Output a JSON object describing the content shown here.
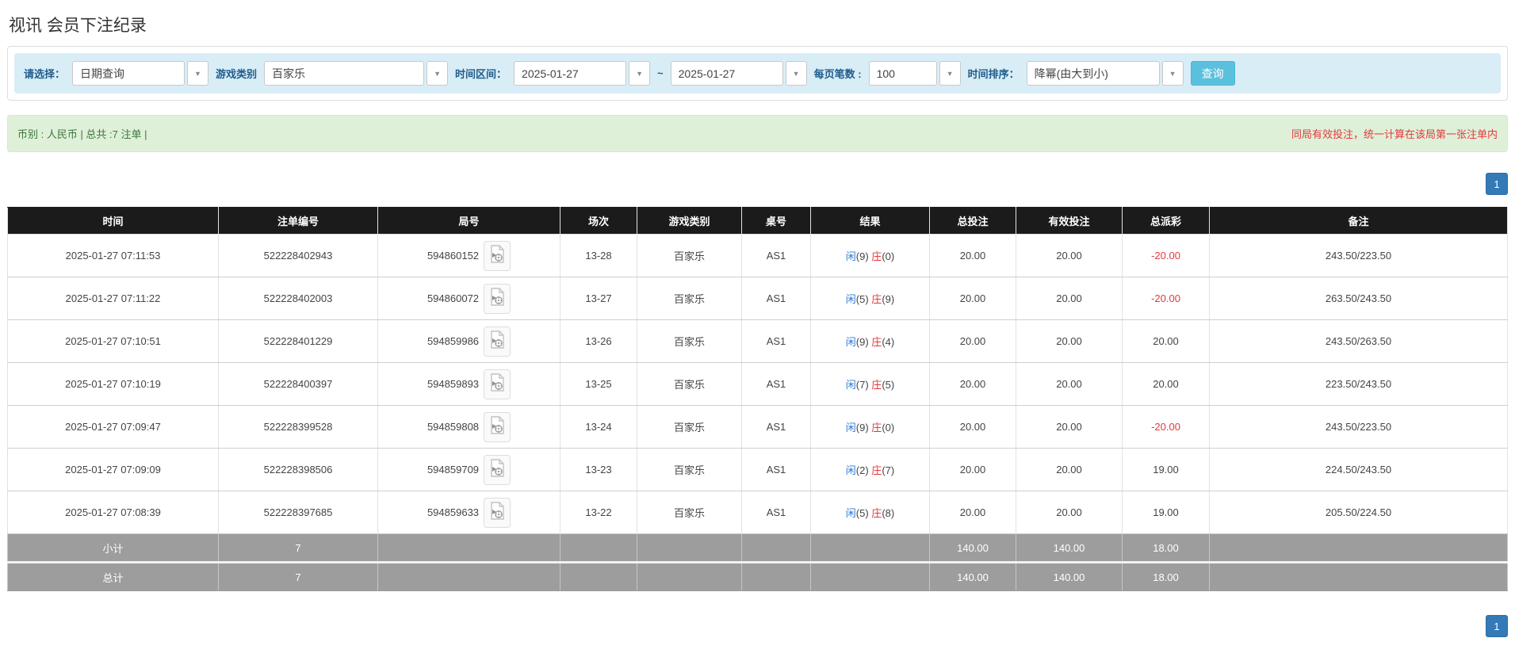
{
  "page_title": "视讯 会员下注纪录",
  "filters": {
    "select_label": "请选择：",
    "query_type": "日期查询",
    "game_category_label": "游戏类别",
    "game_category": "百家乐",
    "date_range_label": "时间区间：",
    "date_from": "2025-01-27",
    "date_tilde": "~",
    "date_to": "2025-01-27",
    "page_size_label": "每页笔数 :",
    "page_size": "100",
    "sort_label": "时间排序：",
    "sort_order": "降幂(由大到小)",
    "search_button": "查询",
    "dropdown_arrow": "▼"
  },
  "summary_bar": {
    "left_text": "币别 : 人民币 | 总共 :7 注单 |",
    "right_notice": "同局有效投注，统一计算在该局第一张注单内"
  },
  "pagination": {
    "page": "1"
  },
  "table": {
    "columns": [
      "时间",
      "注单编号",
      "局号",
      "场次",
      "游戏类别",
      "桌号",
      "结果",
      "总投注",
      "有效投注",
      "总派彩",
      "备注"
    ],
    "rows": [
      {
        "time": "2025-01-27 07:11:53",
        "bet_id": "522228402943",
        "round_id": "594860152",
        "session": "13-28",
        "game": "百家乐",
        "table_no": "AS1",
        "result_player": "闲",
        "result_player_pts": "(9)",
        "result_banker": "庄",
        "result_banker_pts": "(0)",
        "total_bet": "20.00",
        "valid_bet": "20.00",
        "payout": "-20.00",
        "remark": "243.50/223.50"
      },
      {
        "time": "2025-01-27 07:11:22",
        "bet_id": "522228402003",
        "round_id": "594860072",
        "session": "13-27",
        "game": "百家乐",
        "table_no": "AS1",
        "result_player": "闲",
        "result_player_pts": "(5)",
        "result_banker": "庄",
        "result_banker_pts": "(9)",
        "total_bet": "20.00",
        "valid_bet": "20.00",
        "payout": "-20.00",
        "remark": "263.50/243.50"
      },
      {
        "time": "2025-01-27 07:10:51",
        "bet_id": "522228401229",
        "round_id": "594859986",
        "session": "13-26",
        "game": "百家乐",
        "table_no": "AS1",
        "result_player": "闲",
        "result_player_pts": "(9)",
        "result_banker": "庄",
        "result_banker_pts": "(4)",
        "total_bet": "20.00",
        "valid_bet": "20.00",
        "payout": "20.00",
        "remark": "243.50/263.50"
      },
      {
        "time": "2025-01-27 07:10:19",
        "bet_id": "522228400397",
        "round_id": "594859893",
        "session": "13-25",
        "game": "百家乐",
        "table_no": "AS1",
        "result_player": "闲",
        "result_player_pts": "(7)",
        "result_banker": "庄",
        "result_banker_pts": "(5)",
        "total_bet": "20.00",
        "valid_bet": "20.00",
        "payout": "20.00",
        "remark": "223.50/243.50"
      },
      {
        "time": "2025-01-27 07:09:47",
        "bet_id": "522228399528",
        "round_id": "594859808",
        "session": "13-24",
        "game": "百家乐",
        "table_no": "AS1",
        "result_player": "闲",
        "result_player_pts": "(9)",
        "result_banker": "庄",
        "result_banker_pts": "(0)",
        "total_bet": "20.00",
        "valid_bet": "20.00",
        "payout": "-20.00",
        "remark": "243.50/223.50"
      },
      {
        "time": "2025-01-27 07:09:09",
        "bet_id": "522228398506",
        "round_id": "594859709",
        "session": "13-23",
        "game": "百家乐",
        "table_no": "AS1",
        "result_player": "闲",
        "result_player_pts": "(2)",
        "result_banker": "庄",
        "result_banker_pts": "(7)",
        "total_bet": "20.00",
        "valid_bet": "20.00",
        "payout": "19.00",
        "remark": "224.50/243.50"
      },
      {
        "time": "2025-01-27 07:08:39",
        "bet_id": "522228397685",
        "round_id": "594859633",
        "session": "13-22",
        "game": "百家乐",
        "table_no": "AS1",
        "result_player": "闲",
        "result_player_pts": "(5)",
        "result_banker": "庄",
        "result_banker_pts": "(8)",
        "total_bet": "20.00",
        "valid_bet": "20.00",
        "payout": "19.00",
        "remark": "205.50/224.50"
      }
    ],
    "subtotal": {
      "label": "小计",
      "count": "7",
      "total_bet": "140.00",
      "valid_bet": "140.00",
      "payout": "18.00"
    },
    "grand_total": {
      "label": "总计",
      "count": "7",
      "total_bet": "140.00",
      "valid_bet": "140.00",
      "payout": "18.00"
    }
  },
  "colors": {
    "accent_blue": "#2b7bd9",
    "result_red": "#e4393c",
    "header_bg": "#1b1b1b",
    "summary_row_bg": "#9d9d9d",
    "filter_bg": "#d9edf7",
    "notice_bg": "#dff0d8",
    "search_btn": "#5bc0de",
    "pager_btn": "#337ab7"
  }
}
